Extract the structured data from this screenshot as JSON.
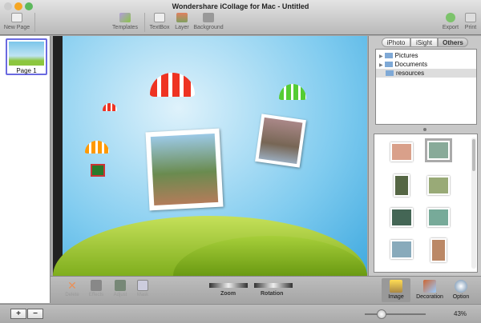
{
  "window": {
    "title": "Wondershare iCollage for Mac - Untitled"
  },
  "toolbar": {
    "new_page": "New Page",
    "templates": "Templates",
    "textbox": "TextBox",
    "layer": "Layer",
    "background": "Background",
    "export": "Export",
    "print": "Print"
  },
  "pages": [
    {
      "label": "Page 1"
    }
  ],
  "source_tabs": [
    {
      "label": "iPhoto"
    },
    {
      "label": "iSight"
    },
    {
      "label": "Others",
      "active": true
    }
  ],
  "tree": [
    {
      "label": "Pictures",
      "expandable": true
    },
    {
      "label": "Documents",
      "expandable": true
    },
    {
      "label": "resources",
      "selected": true
    }
  ],
  "edit_tools": {
    "delete": "Delete",
    "effects": "Effects",
    "adjust": "Adjust",
    "mask": "Mask",
    "zoom": "Zoom",
    "rotation": "Rotation"
  },
  "panels": {
    "image": "Image",
    "decoration": "Decoration",
    "option": "Option"
  },
  "status": {
    "add": "+",
    "remove": "−",
    "zoom_percent": "43%",
    "zoom_value": 43
  },
  "colors": {
    "selection": "#6a6ae0",
    "sky": "#7fcbef",
    "grass": "#8cc63f"
  }
}
